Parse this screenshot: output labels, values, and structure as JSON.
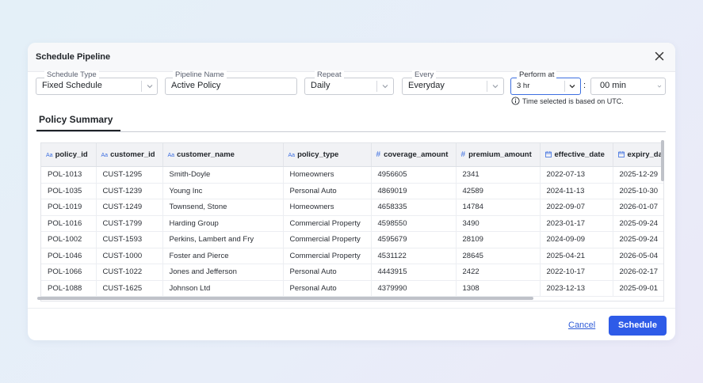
{
  "dialog": {
    "title": "Schedule Pipeline"
  },
  "form": {
    "schedule_type": {
      "label": "Schedule Type",
      "value": "Fixed Schedule"
    },
    "pipeline_name": {
      "label": "Pipeline Name",
      "value": "Active Policy"
    },
    "repeat": {
      "label": "Repeat",
      "value": "Daily"
    },
    "every": {
      "label": "Every",
      "value": "Everyday"
    },
    "perform_at": {
      "label": "Perform at",
      "hour": "3 hr",
      "separator": ":",
      "minute": "00 min"
    },
    "utc_note": "Time selected is based on UTC."
  },
  "tabs": [
    {
      "label": "Policy Summary",
      "active": true
    }
  ],
  "table": {
    "columns": [
      {
        "name": "policy_id",
        "type_icon": "text-type-icon"
      },
      {
        "name": "customer_id",
        "type_icon": "text-type-icon"
      },
      {
        "name": "customer_name",
        "type_icon": "text-type-icon"
      },
      {
        "name": "policy_type",
        "type_icon": "text-type-icon"
      },
      {
        "name": "coverage_amount",
        "type_icon": "number-type-icon"
      },
      {
        "name": "premium_amount",
        "type_icon": "number-type-icon"
      },
      {
        "name": "effective_date",
        "type_icon": "date-type-icon"
      },
      {
        "name": "expiry_date",
        "type_icon": "date-type-icon"
      }
    ],
    "rows": [
      [
        "POL-1013",
        "CUST-1295",
        "Smith-Doyle",
        "Homeowners",
        "4956605",
        "2341",
        "2022-07-13",
        "2025-12-29"
      ],
      [
        "POL-1035",
        "CUST-1239",
        "Young Inc",
        "Personal Auto",
        "4869019",
        "42589",
        "2024-11-13",
        "2025-10-30"
      ],
      [
        "POL-1019",
        "CUST-1249",
        "Townsend, Stone",
        "Homeowners",
        "4658335",
        "14784",
        "2022-09-07",
        "2026-01-07"
      ],
      [
        "POL-1016",
        "CUST-1799",
        "Harding Group",
        "Commercial Property",
        "4598550",
        "3490",
        "2023-01-17",
        "2025-09-24"
      ],
      [
        "POL-1002",
        "CUST-1593",
        "Perkins, Lambert and Fry",
        "Commercial Property",
        "4595679",
        "28109",
        "2024-09-09",
        "2025-09-24"
      ],
      [
        "POL-1046",
        "CUST-1000",
        "Foster and Pierce",
        "Commercial Property",
        "4531122",
        "28645",
        "2025-04-21",
        "2026-05-04"
      ],
      [
        "POL-1066",
        "CUST-1022",
        "Jones and Jefferson",
        "Personal Auto",
        "4443915",
        "2422",
        "2022-10-17",
        "2026-02-17"
      ],
      [
        "POL-1088",
        "CUST-1625",
        "Johnson Ltd",
        "Personal Auto",
        "4379990",
        "1308",
        "2023-12-13",
        "2025-09-01"
      ]
    ]
  },
  "footer": {
    "cancel_label": "Cancel",
    "schedule_label": "Schedule"
  },
  "colors": {
    "accent": "#2e5be8",
    "link": "#2e5bd8"
  }
}
